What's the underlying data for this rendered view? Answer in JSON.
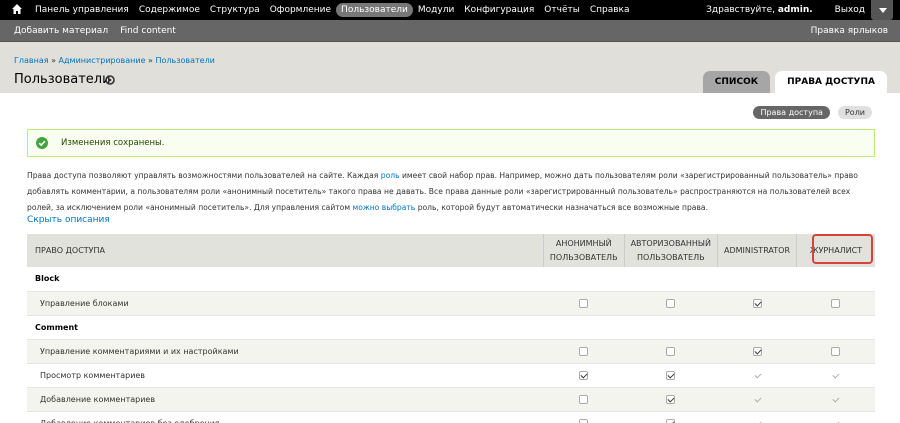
{
  "toolbar": {
    "menu": [
      "Панель управления",
      "Содержимое",
      "Структура",
      "Оформление",
      "Пользователи",
      "Модули",
      "Конфигурация",
      "Отчёты",
      "Справка"
    ],
    "active_index": 4,
    "greeting": "Здравствуйте,",
    "username": "admin.",
    "logout": "Выход"
  },
  "shortcuts": {
    "items": [
      "Добавить материал",
      "Find content"
    ],
    "edit": "Правка ярлыков"
  },
  "breadcrumb": [
    "Главная",
    "Администрирование",
    "Пользователи"
  ],
  "page_title": "Пользователи",
  "tabs": {
    "list": "СПИСОК",
    "permissions": "ПРАВА ДОСТУПА"
  },
  "subtabs": {
    "permissions": "Права доступа",
    "roles": "Роли"
  },
  "message": "Изменения сохранены.",
  "description": {
    "p1": "Права доступа позволяют управлять возможностями пользователей на сайте. Каждая",
    "link1": "роль",
    "p2": "имеет свой набор прав. Например, можно дать пользователям роли «зарегистрированный пользователь» право добавлять комментарии, а пользователям роли «анонимный посетитель» такого права не давать. Все права данные роли «зарегистрированный пользователь» распространяются на пользователей всех ролей, за исключением роли «анонимный посетитель». Для управления сайтом",
    "link2": "можно выбрать",
    "p3": "роль, которой будут автоматически назначаться все возможные права."
  },
  "hide_descriptions": "Скрыть описания",
  "table": {
    "header": {
      "permission": "ПРАВО ДОСТУПА",
      "anon_line1": "АНОНИМНЫЙ",
      "anon_line2": "ПОЛЬЗОВАТЕЛЬ",
      "auth_line1": "АВТОРИЗОВАННЫЙ",
      "auth_line2": "ПОЛЬЗОВАТЕЛЬ",
      "admin": "ADMINISTRATOR",
      "journalist": "ЖУРНАЛИСТ"
    },
    "modules": [
      {
        "name": "Block"
      },
      {
        "name": "Comment"
      }
    ],
    "rows": [
      {
        "label": "Управление блоками"
      },
      {
        "label": "Управление комментариями и их настройками"
      },
      {
        "label": "Просмотр комментариев"
      },
      {
        "label": "Добавление комментариев"
      },
      {
        "label": "Добавление комментариев без одобрения"
      }
    ]
  }
}
